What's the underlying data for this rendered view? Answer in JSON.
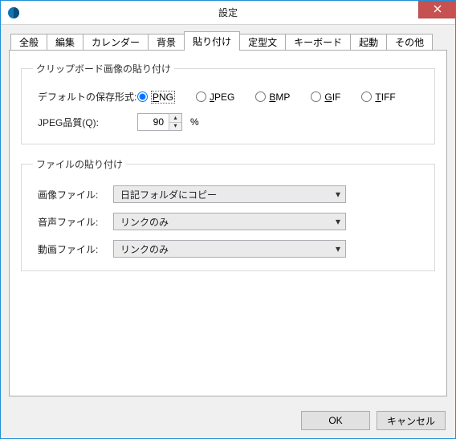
{
  "window": {
    "title": "設定"
  },
  "tabs": [
    {
      "label": "全般"
    },
    {
      "label": "編集"
    },
    {
      "label": "カレンダー"
    },
    {
      "label": "背景"
    },
    {
      "label": "貼り付け"
    },
    {
      "label": "定型文"
    },
    {
      "label": "キーボード"
    },
    {
      "label": "起動"
    },
    {
      "label": "その他"
    }
  ],
  "active_tab_index": 4,
  "group1": {
    "legend": "クリップボード画像の貼り付け",
    "default_format_label": "デフォルトの保存形式:",
    "formats": {
      "png": {
        "u": "P",
        "rest": "NG",
        "checked": true
      },
      "jpeg": {
        "u": "J",
        "rest": "PEG",
        "checked": false
      },
      "bmp": {
        "u": "B",
        "rest": "MP",
        "checked": false
      },
      "gif": {
        "u": "G",
        "rest": "IF",
        "checked": false
      },
      "tiff": {
        "u": "T",
        "rest": "IFF",
        "checked": false
      }
    },
    "jpeg_quality_label": "JPEG品質(Q):",
    "jpeg_quality_value": "90",
    "pct": "%"
  },
  "group2": {
    "legend": "ファイルの貼り付け",
    "image_label": "画像ファイル:",
    "image_value": "日記フォルダにコピー",
    "audio_label": "音声ファイル:",
    "audio_value": "リンクのみ",
    "video_label": "動画ファイル:",
    "video_value": "リンクのみ"
  },
  "buttons": {
    "ok": "OK",
    "cancel": "キャンセル"
  }
}
